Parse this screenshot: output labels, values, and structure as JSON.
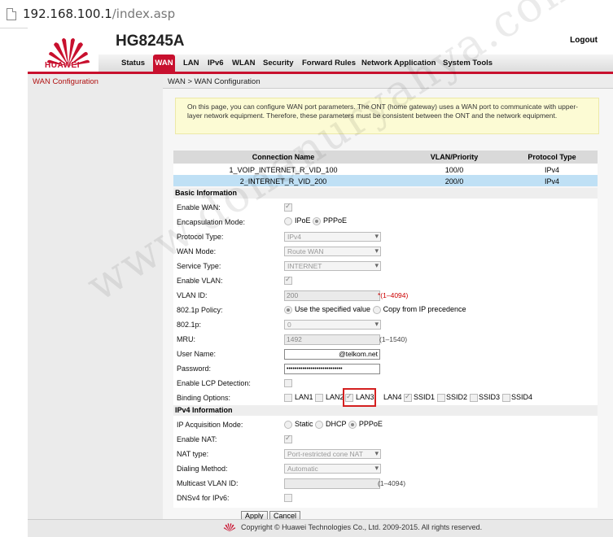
{
  "browser": {
    "url_host": "192.168.100.1",
    "url_path": "/index.asp"
  },
  "header": {
    "brand": "HUAWEI",
    "model": "HG8245A",
    "logout": "Logout"
  },
  "nav": {
    "tabs": [
      "Status",
      "WAN",
      "LAN",
      "IPv6",
      "WLAN",
      "Security",
      "Forward Rules",
      "Network Application",
      "System Tools"
    ],
    "active": "WAN"
  },
  "sidebar": {
    "items": [
      "WAN Configuration"
    ]
  },
  "breadcrumb": "WAN > WAN Configuration",
  "info": "On this page, you can configure WAN port parameters. The ONT (home gateway) uses a WAN port to communicate with upper-layer network equipment. Therefore, these parameters must be consistent between the ONT and the network equipment.",
  "connections": {
    "headers": [
      "Connection Name",
      "VLAN/Priority",
      "Protocol Type"
    ],
    "rows": [
      {
        "name": "1_VOIP_INTERNET_R_VID_100",
        "vlan": "100/0",
        "proto": "IPv4"
      },
      {
        "name": "2_INTERNET_R_VID_200",
        "vlan": "200/0",
        "proto": "IPv4"
      }
    ]
  },
  "basic": {
    "title": "Basic Information",
    "enable_wan": "Enable WAN:",
    "encap": "Encapsulation Mode:",
    "encap_opt1": "IPoE",
    "encap_opt2": "PPPoE",
    "proto": "Protocol Type:",
    "proto_val": "IPv4",
    "wan_mode": "WAN Mode:",
    "wan_mode_val": "Route WAN",
    "service": "Service Type:",
    "service_val": "INTERNET",
    "enable_vlan": "Enable VLAN:",
    "vlan_id": "VLAN ID:",
    "vlan_id_val": "200",
    "vlan_id_hint": "*(1–4094)",
    "policy": "802.1p Policy:",
    "policy_opt1": "Use the specified value",
    "policy_opt2": "Copy from IP precedence",
    "p8021": "802.1p:",
    "p8021_val": "0",
    "mru": "MRU:",
    "mru_val": "1492",
    "mru_hint": "(1–1540)",
    "user": "User Name:",
    "user_val": "@telkom.net",
    "pass": "Password:",
    "pass_val": "••••••••••••••••••••••••••••",
    "lcp": "Enable LCP Detection:",
    "binding": "Binding Options:",
    "bind_opts": [
      "LAN1",
      "LAN2",
      "LAN3",
      "LAN4",
      "SSID1",
      "SSID2",
      "SSID3",
      "SSID4"
    ]
  },
  "ipv4": {
    "title": "IPv4 Information",
    "acq": "IP Acquisition Mode:",
    "acq_opts": [
      "Static",
      "DHCP",
      "PPPoE"
    ],
    "nat": "Enable NAT:",
    "nat_type": "NAT type:",
    "nat_type_val": "Port-restricted cone NAT",
    "dial": "Dialing Method:",
    "dial_val": "Automatic",
    "mvlan": "Multicast VLAN ID:",
    "mvlan_hint": "(1–4094)",
    "dnsv4": "DNSv4 for IPv6:"
  },
  "buttons": {
    "apply": "Apply",
    "cancel": "Cancel"
  },
  "footer": "Copyright © Huawei Technologies Co., Ltd. 2009-2015. All rights reserved.",
  "watermark": "www.donanuryahya.com",
  "colors": {
    "brand_red": "#c8102e",
    "selected_row": "#bfe0f5",
    "info_bg": "#fcfbd4"
  }
}
